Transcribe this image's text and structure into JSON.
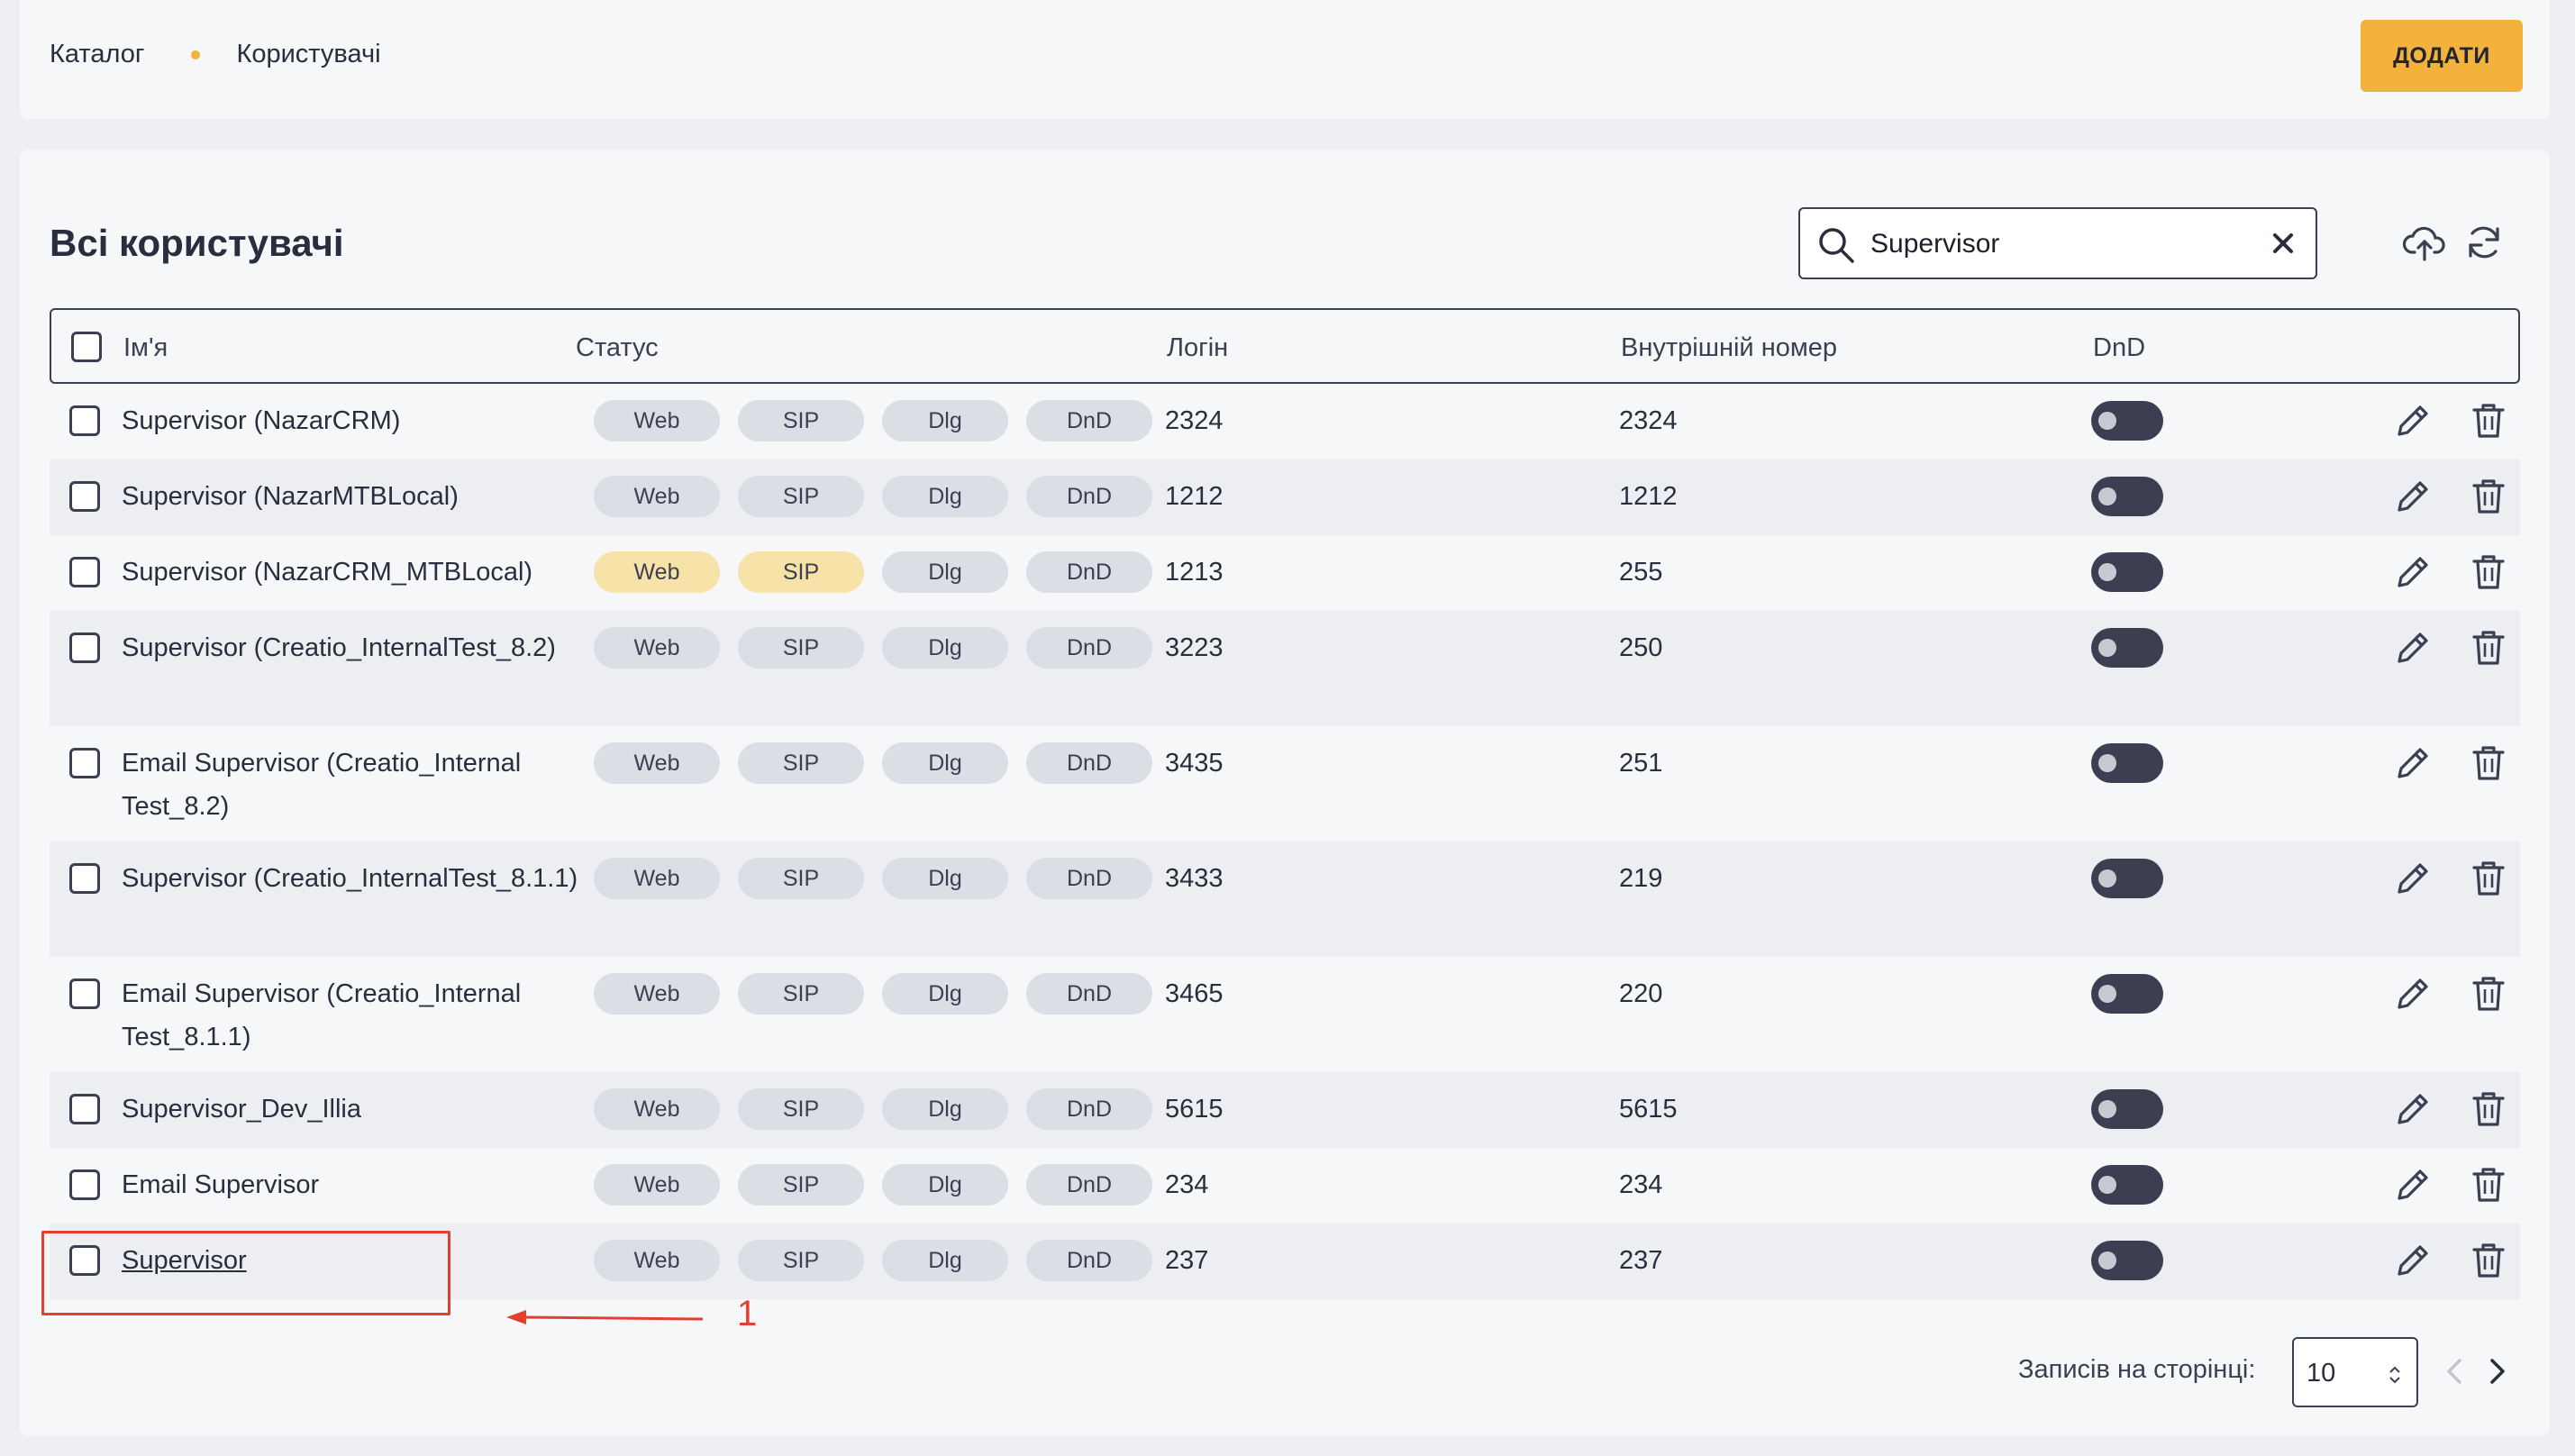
{
  "breadcrumb": {
    "catalog": "Каталог",
    "users": "Користувачі"
  },
  "actions": {
    "add_label": "ДОДАТИ"
  },
  "panel": {
    "title": "Всі користувачі"
  },
  "search": {
    "value": "Supervisor",
    "placeholder": ""
  },
  "table": {
    "columns": {
      "name": "Ім'я",
      "status": "Статус",
      "login": "Логін",
      "ext": "Внутрішній номер",
      "dnd": "DnD"
    },
    "status_labels": [
      "Web",
      "SIP",
      "Dlg",
      "DnD"
    ],
    "rows": [
      {
        "name": "Supervisor (NazarCRM)",
        "login": "2324",
        "ext": "2324",
        "active": []
      },
      {
        "name": "Supervisor (NazarMTBLocal)",
        "login": "1212",
        "ext": "1212",
        "active": []
      },
      {
        "name": "Supervisor (NazarCRM_MTBLocal)",
        "login": "1213",
        "ext": "255",
        "active": [
          "Web",
          "SIP"
        ]
      },
      {
        "name": "Supervisor (Creatio_InternalTest_8.2)",
        "login": "3223",
        "ext": "250",
        "active": []
      },
      {
        "name": "Email Supervisor (Creatio_Internal Test_8.2)",
        "login": "3435",
        "ext": "251",
        "active": []
      },
      {
        "name": "Supervisor (Creatio_InternalTest_8.1.1)",
        "login": "3433",
        "ext": "219",
        "active": []
      },
      {
        "name": "Email Supervisor (Creatio_Internal Test_8.1.1)",
        "login": "3465",
        "ext": "220",
        "active": []
      },
      {
        "name": "Supervisor_Dev_Illia",
        "login": "5615",
        "ext": "5615",
        "active": []
      },
      {
        "name": "Email Supervisor",
        "login": "234",
        "ext": "234",
        "active": []
      },
      {
        "name": "Supervisor",
        "login": "237",
        "ext": "237",
        "active": [],
        "link": true
      }
    ]
  },
  "annotation": {
    "number": "1"
  },
  "pagination": {
    "label": "Записів на сторінці:",
    "per_page": "10"
  },
  "colors": {
    "accent": "#f2b23c",
    "annotation": "#e2402f",
    "dark": "#3c3f52"
  },
  "icons": [
    "search-icon",
    "close-icon",
    "upload-icon",
    "refresh-icon",
    "pencil-icon",
    "trash-icon",
    "chevron-left-icon",
    "chevron-right-icon"
  ]
}
